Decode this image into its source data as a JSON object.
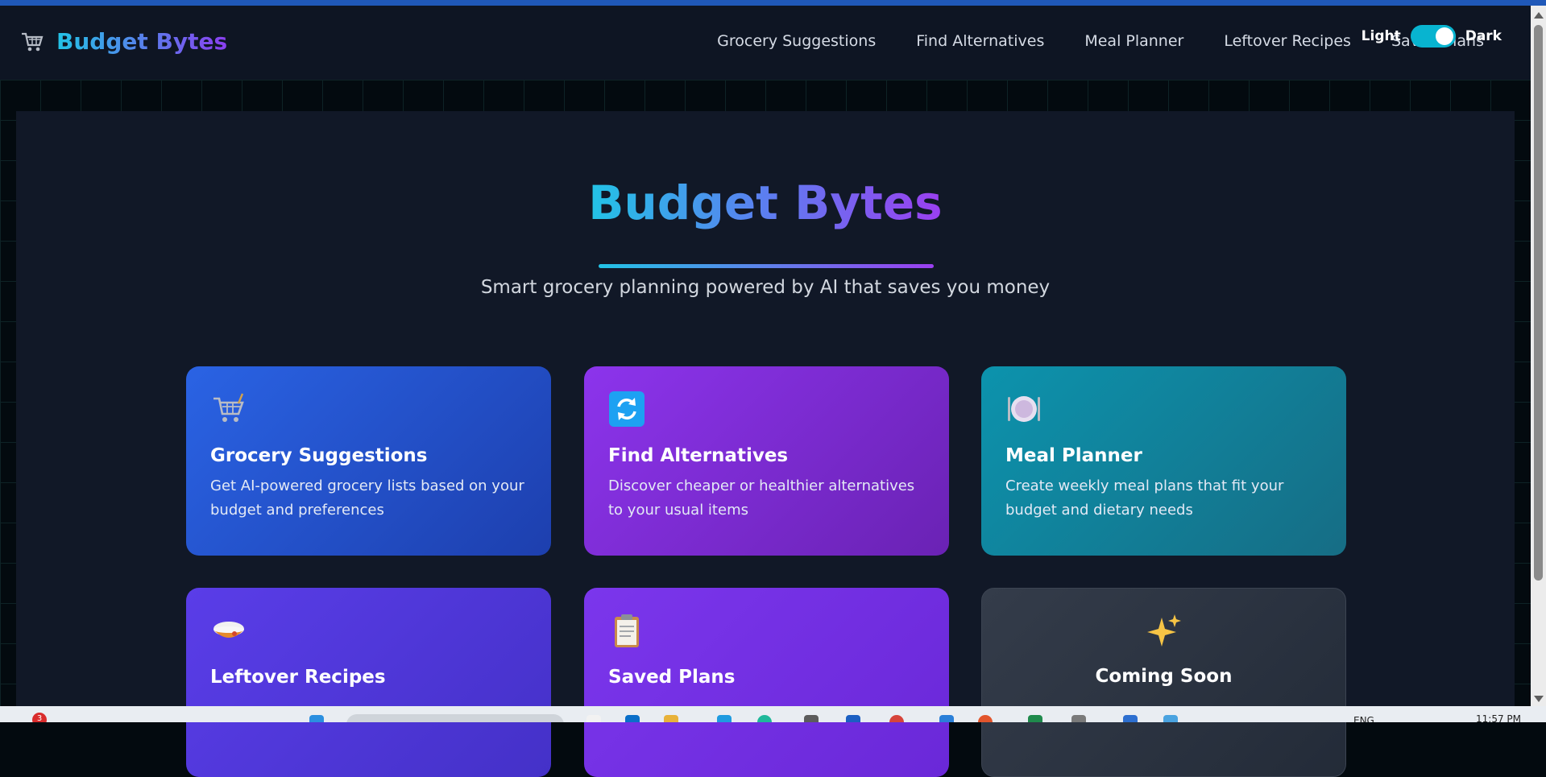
{
  "app": {
    "brand": "Budget Bytes"
  },
  "nav": {
    "items": [
      {
        "label": "Grocery Suggestions"
      },
      {
        "label": "Find Alternatives"
      },
      {
        "label": "Meal Planner"
      },
      {
        "label": "Leftover Recipes"
      },
      {
        "label": "Saved Plans"
      }
    ]
  },
  "theme_toggle": {
    "light_label": "Light",
    "dark_label": "Dark",
    "state": "dark"
  },
  "hero": {
    "title": "Budget Bytes",
    "subtitle": "Smart grocery planning powered by AI that saves you money"
  },
  "cards": [
    {
      "icon": "shopping-cart-icon",
      "title": "Grocery Suggestions",
      "description": "Get AI-powered grocery lists based on your budget and preferences"
    },
    {
      "icon": "refresh-icon",
      "title": "Find Alternatives",
      "description": "Discover cheaper or healthier alternatives to your usual items"
    },
    {
      "icon": "plate-cutlery-icon",
      "title": "Meal Planner",
      "description": "Create weekly meal plans that fit your budget and dietary needs"
    },
    {
      "icon": "food-bowl-icon",
      "title": "Leftover Recipes",
      "description": ""
    },
    {
      "icon": "clipboard-icon",
      "title": "Saved Plans",
      "description": ""
    },
    {
      "icon": "sparkles-icon",
      "title": "Coming Soon",
      "description": ""
    }
  ],
  "taskbar": {
    "notification_count": "3",
    "language": "ENG",
    "time": "11:57 PM"
  },
  "colors": {
    "background": "#030a0f",
    "navbar": "#0e1523",
    "panel": "#111827",
    "accent_cyan": "#22c3e6",
    "accent_purple": "#9b3ff0",
    "toggle": "#08b4d0"
  }
}
